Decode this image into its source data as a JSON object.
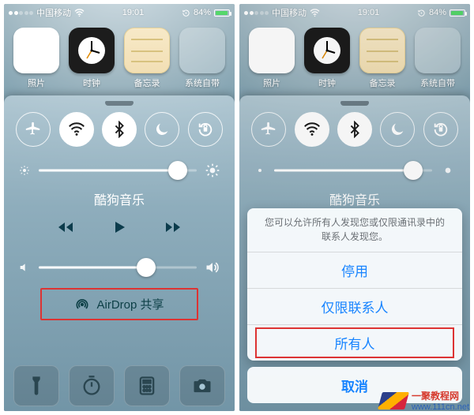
{
  "status": {
    "carrier": "中国移动",
    "time": "19:01",
    "battery_pct": "84%",
    "battery_fill_pct": 84,
    "signal_bars": 5,
    "signal_active": 2
  },
  "apps": {
    "photos": "照片",
    "clock": "时钟",
    "notes": "备忘录",
    "utilities": "系统自带"
  },
  "cc": {
    "music_title": "酷狗音乐",
    "brightness_pct": 88,
    "volume_pct": 68,
    "airdrop_label": "AirDrop 共享",
    "toggles": {
      "airplane": false,
      "wifi": true,
      "bluetooth": true,
      "dnd": false,
      "rotation_lock": false
    }
  },
  "airdrop_sheet": {
    "message": "您可以允许所有人发现您或仅限通讯录中的联系人发现您。",
    "options": {
      "off": "停用",
      "contacts": "仅限联系人",
      "everyone": "所有人"
    },
    "cancel": "取消"
  },
  "watermark": {
    "brand": "一聚教程网",
    "url": "www.111cn.net"
  }
}
